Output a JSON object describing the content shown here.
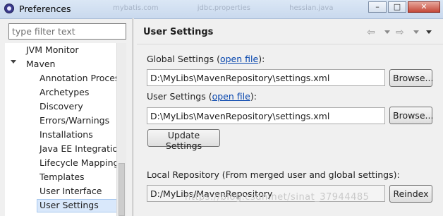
{
  "window": {
    "title": "Preferences",
    "background_tabs": [
      "mybatis.com",
      "jdbc.properties",
      "hessian.java"
    ],
    "controls": {
      "minimize": "–",
      "maximize": "□",
      "close": "✕"
    }
  },
  "sidebar": {
    "filter_placeholder": "type filter text",
    "items": [
      {
        "label": "JVM Monitor"
      },
      {
        "label": "Maven"
      },
      {
        "label": "Annotation Proces"
      },
      {
        "label": "Archetypes"
      },
      {
        "label": "Discovery"
      },
      {
        "label": "Errors/Warnings"
      },
      {
        "label": "Installations"
      },
      {
        "label": "Java EE Integratio"
      },
      {
        "label": "Lifecycle Mapping"
      },
      {
        "label": "Templates"
      },
      {
        "label": "User Interface"
      },
      {
        "label": "User Settings"
      }
    ],
    "selected": "User Settings"
  },
  "page": {
    "title": "User Settings",
    "nav": {
      "back_icon": "⇦",
      "forward_icon": "⇨"
    },
    "global_settings": {
      "label_prefix": "Global Settings (",
      "link": "open file",
      "label_suffix": "):",
      "value": "D:\\MyLibs\\MavenRepository\\settings.xml",
      "browse_label": "Browse..."
    },
    "user_settings": {
      "label_prefix": "User Settings (",
      "link": "open file",
      "label_suffix": "):",
      "value": "D:\\MyLibs\\MavenRepository\\settings.xml",
      "browse_label": "Browse..."
    },
    "update_label": "Update Settings",
    "local_repository": {
      "label": "Local Repository (From merged user and global settings):",
      "value": "D:/MyLibs/MavenRepository",
      "reindex_label": "Reindex"
    }
  },
  "watermark": "https://blog.csdn.net/sinat_37944485",
  "colors": {
    "selection": "#d9e8fb",
    "link": "#0645ad",
    "titlebar": "#c9d9ee"
  }
}
